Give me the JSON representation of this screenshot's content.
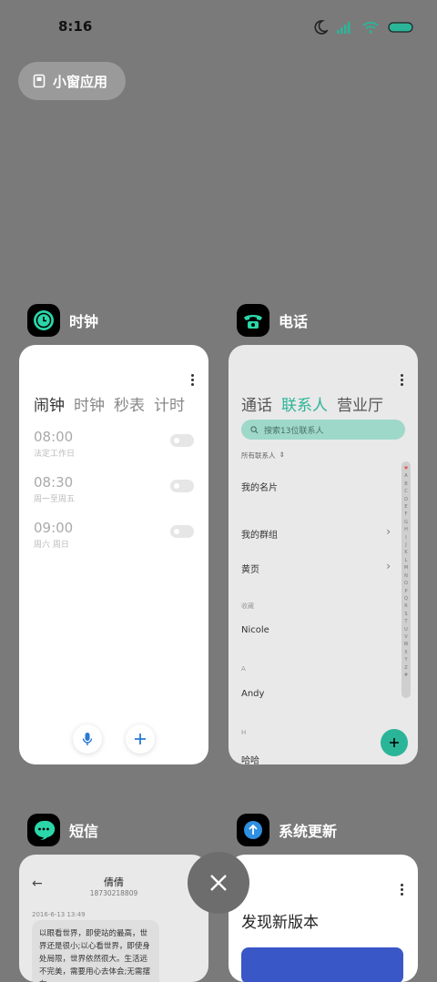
{
  "status_bar": {
    "time": "8:16"
  },
  "mini_window": {
    "label": "小窗应用"
  },
  "clock": {
    "app_name": "时钟",
    "tabs": [
      "闹钟",
      "时钟",
      "秒表",
      "计时"
    ],
    "alarms": [
      {
        "time": "08:00",
        "repeat": "法定工作日"
      },
      {
        "time": "08:30",
        "repeat": "周一至周五"
      },
      {
        "time": "09:00",
        "repeat": "周六 周日"
      }
    ]
  },
  "phone": {
    "app_name": "电话",
    "tabs": [
      "通话",
      "联系人",
      "营业厅"
    ],
    "search_placeholder": "搜索13位联系人",
    "all_contacts": "所有联系人",
    "my_card": "我的名片",
    "my_groups": "我的群组",
    "yellow_pages": "黄页",
    "favorites_label": "收藏",
    "contact_nicole": "Nicole",
    "section_a": "A",
    "contact_andy": "Andy",
    "section_h": "H",
    "contact_haha": "哈哈",
    "alphabet": [
      "♥",
      "A",
      "B",
      "C",
      "D",
      "E",
      "F",
      "G",
      "H",
      "I",
      "J",
      "K",
      "L",
      "M",
      "N",
      "O",
      "P",
      "Q",
      "R",
      "S",
      "T",
      "U",
      "V",
      "W",
      "X",
      "Y",
      "Z",
      "#"
    ]
  },
  "sms": {
    "app_name": "短信",
    "contact_name": "倩倩",
    "contact_number": "18730218809",
    "date": "2016-6-13 13:49",
    "message": "以眼看世界，即使站的最高，世界还是很小;以心看世界，即使身处局限，世界依然很大。生活远不完美，需要用心去体会;无需摆在..."
  },
  "system_update": {
    "app_name": "系统更新",
    "title": "发现新版本"
  },
  "colors": {
    "accent": "#2bb598",
    "background": "#7a7a7a"
  }
}
